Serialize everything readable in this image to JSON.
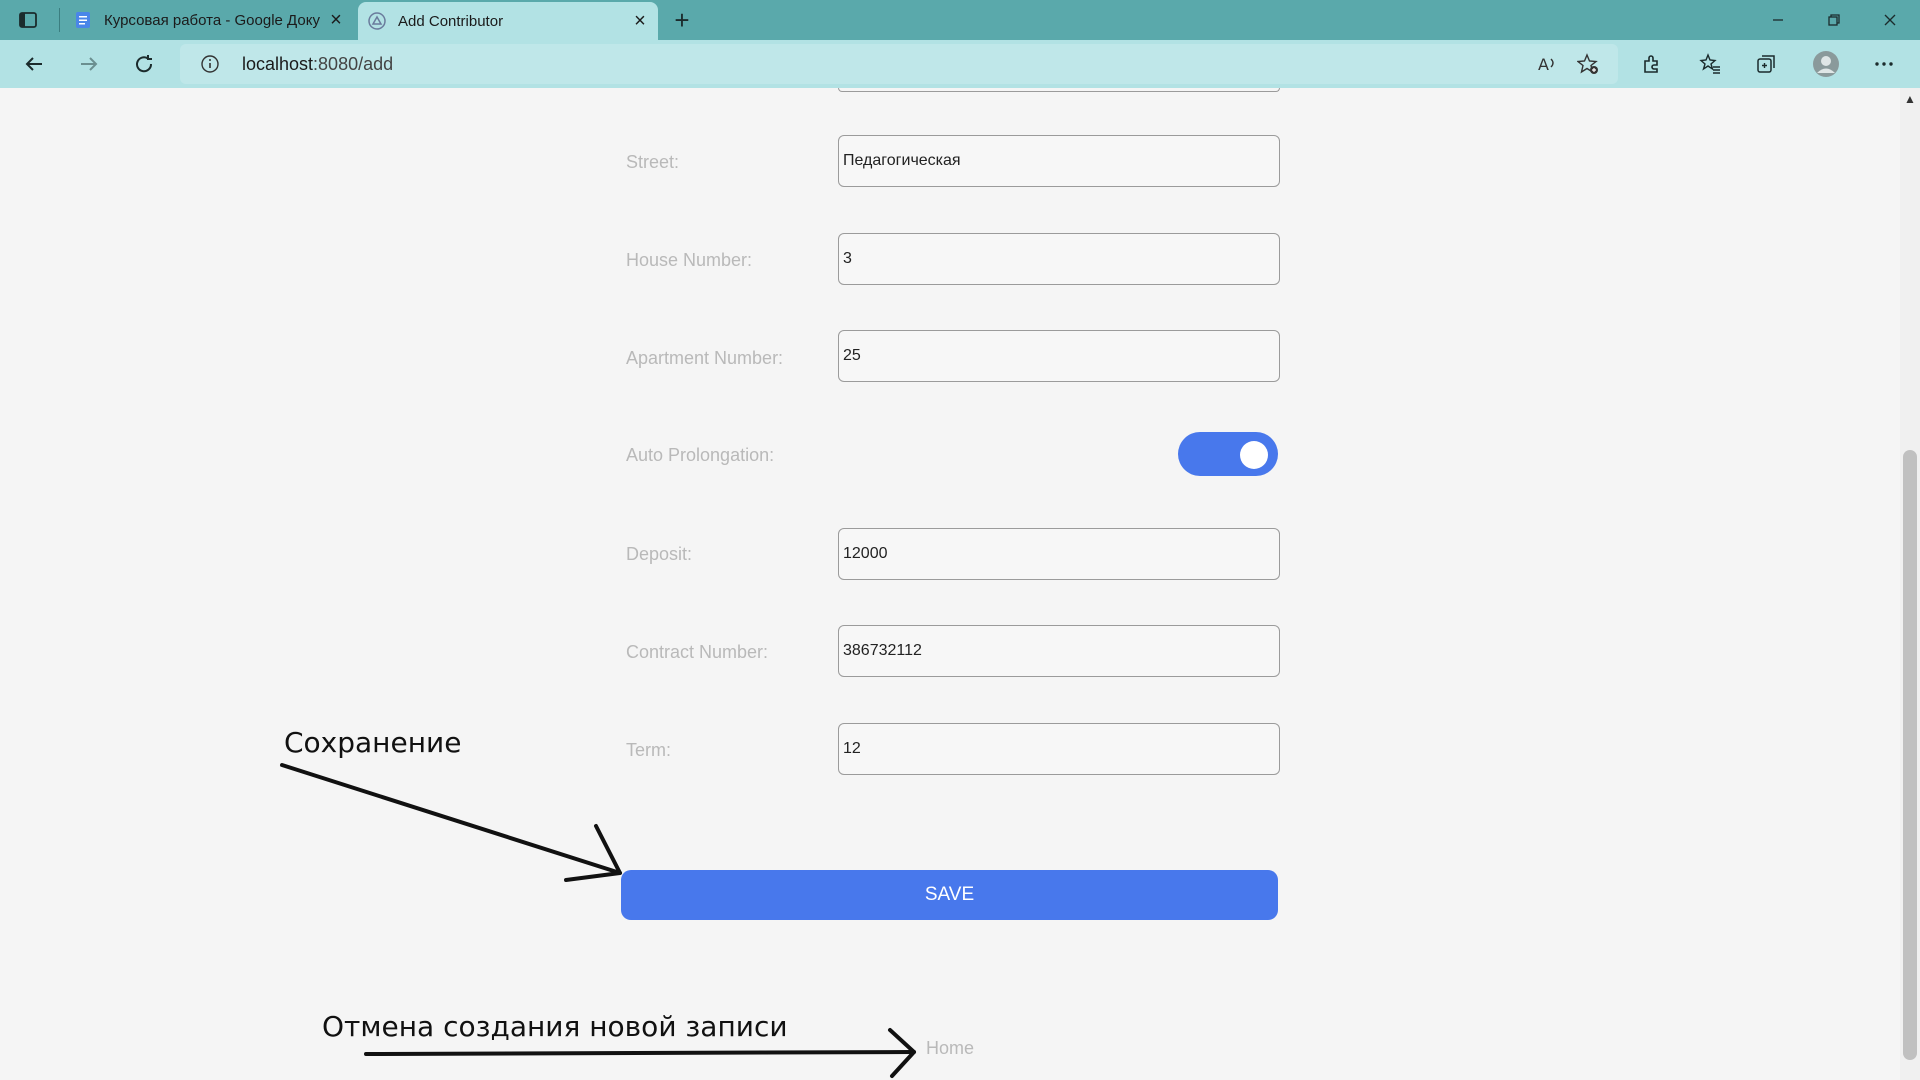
{
  "browser": {
    "tabs": [
      {
        "title": "Курсовая работа - Google Доку",
        "active": false
      },
      {
        "title": "Add Contributor",
        "active": true
      }
    ],
    "address": {
      "host": "localhost",
      "rest": ":8080/add"
    }
  },
  "form": {
    "fields": [
      {
        "label": "Street:",
        "value": "Педагогическая"
      },
      {
        "label": "House Number:",
        "value": "3"
      },
      {
        "label": "Apartment Number:",
        "value": "25"
      },
      {
        "label": "Auto Prolongation:",
        "toggle_on": true
      },
      {
        "label": "Deposit:",
        "value": "12000"
      },
      {
        "label": "Contract Number:",
        "value": "386732112"
      },
      {
        "label": "Term:",
        "value": "12"
      }
    ],
    "save_label": "SAVE",
    "home_link": "Home"
  },
  "annotations": {
    "save_note": "Сохранение",
    "cancel_note": "Отмена создания новой записи"
  },
  "colors": {
    "primary": "#4878ec",
    "titlebar": "#5aa9ab",
    "toolbar": "#b2e2e4"
  }
}
